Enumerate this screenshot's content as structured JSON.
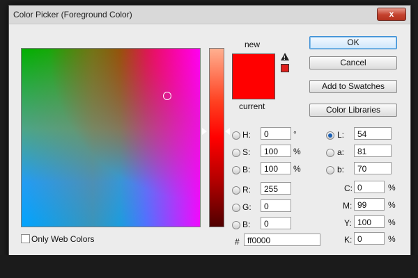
{
  "window": {
    "title": "Color Picker (Foreground Color)",
    "close_label": "x"
  },
  "colors": {
    "new_color": "#ff0000",
    "current_color": "#ff0000",
    "warning_swatch": "#e0201c"
  },
  "labels": {
    "new": "new",
    "current": "current"
  },
  "buttons": {
    "ok": "OK",
    "cancel": "Cancel",
    "add_to_swatches": "Add to Swatches",
    "color_libraries": "Color Libraries"
  },
  "hsb": {
    "h_label": "H:",
    "h_value": "0",
    "h_unit": "°",
    "s_label": "S:",
    "s_value": "100",
    "s_unit": "%",
    "b_label": "B:",
    "b_value": "100",
    "b_unit": "%"
  },
  "rgb": {
    "r_label": "R:",
    "r_value": "255",
    "g_label": "G:",
    "g_value": "0",
    "b_label": "B:",
    "b_value": "0"
  },
  "lab": {
    "l_label": "L:",
    "l_value": "54",
    "a_label": "a:",
    "a_value": "81",
    "b_label": "b:",
    "b_value": "70",
    "selected": "L"
  },
  "cmyk": {
    "c_label": "C:",
    "c_value": "0",
    "c_unit": "%",
    "m_label": "M:",
    "m_value": "99",
    "m_unit": "%",
    "y_label": "Y:",
    "y_value": "100",
    "y_unit": "%",
    "k_label": "K:",
    "k_value": "0",
    "k_unit": "%"
  },
  "hex": {
    "label": "#",
    "value": "ff0000"
  },
  "only_web_colors": {
    "label": "Only Web Colors",
    "checked": false
  }
}
